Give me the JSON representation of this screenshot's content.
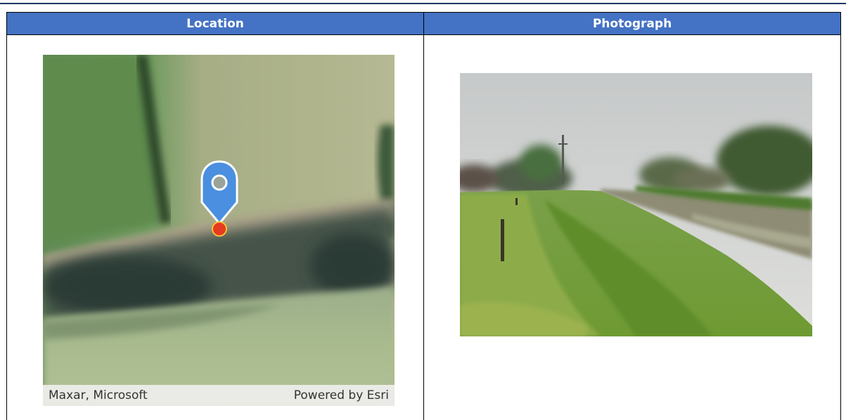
{
  "table": {
    "headers": {
      "location": "Location",
      "photograph": "Photograph"
    }
  },
  "map": {
    "attribution_left": "Maxar, Microsoft",
    "attribution_right": "Powered by Esri",
    "basemap": "satellite imagery",
    "marker": {
      "icon": "location-pin-icon",
      "pin_color": "#4a8fe0",
      "point_color": "#e53b1e"
    }
  },
  "photo": {
    "subject": "grassy riverbank with water channel under overcast sky"
  },
  "colors": {
    "header_bg": "#4472c4",
    "header_text": "#ffffff",
    "rule": "#1f3864"
  }
}
